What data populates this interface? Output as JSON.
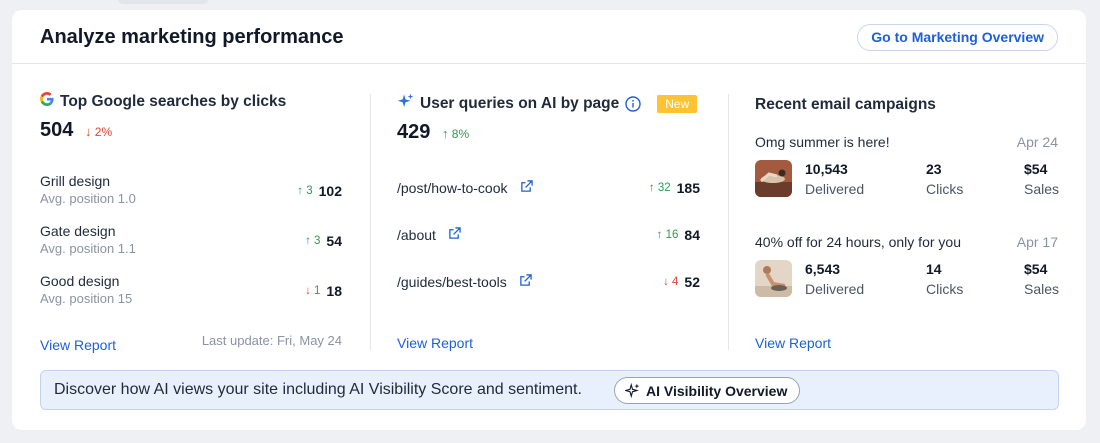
{
  "header": {
    "title": "Analyze marketing performance",
    "overview_button": "Go to Marketing Overview"
  },
  "google": {
    "title": "Top Google searches by clicks",
    "total": "504",
    "trend": "2%",
    "trend_dir": "down",
    "rows": [
      {
        "name": "Grill design",
        "position": "Avg. position 1.0",
        "delta": "3",
        "dir": "up",
        "value": "102"
      },
      {
        "name": "Gate design",
        "position": "Avg. position 1.1",
        "delta": "3",
        "dir": "up",
        "value": "54"
      },
      {
        "name": "Good design",
        "position": "Avg. position 15",
        "delta": "1",
        "dir": "down",
        "value": "18"
      }
    ],
    "view_report": "View Report",
    "last_update": "Last update: Fri, May 24"
  },
  "ai_queries": {
    "title": "User queries on AI by page",
    "badge": "New",
    "total": "429",
    "trend": "8%",
    "trend_dir": "up",
    "rows": [
      {
        "path": "/post/how-to-cook",
        "delta": "32",
        "dir": "up",
        "value": "185"
      },
      {
        "path": "/about",
        "delta": "16",
        "dir": "up",
        "value": "84"
      },
      {
        "path": "/guides/best-tools",
        "delta": "4",
        "dir": "down",
        "value": "52"
      }
    ],
    "view_report": "View Report"
  },
  "email": {
    "title": "Recent email campaigns",
    "campaigns": [
      {
        "name": "Omg summer is here!",
        "date": "Apr 24",
        "delivered": "10,543",
        "delivered_label": "Delivered",
        "clicks": "23",
        "clicks_label": "Clicks",
        "sales": "$54",
        "sales_label": "Sales"
      },
      {
        "name": "40% off for 24 hours, only for you",
        "date": "Apr 17",
        "delivered": "6,543",
        "delivered_label": "Delivered",
        "clicks": "14",
        "clicks_label": "Clicks",
        "sales": "$54",
        "sales_label": "Sales"
      }
    ],
    "view_report": "View Report"
  },
  "banner": {
    "text": "Discover how AI views your site including AI Visibility Score and sentiment.",
    "button": "AI Visibility Overview"
  },
  "colors": {
    "link": "#1f5fd8",
    "up": "#2f9b4a",
    "down": "#e0463a",
    "new_badge": "#ffc233",
    "banner_bg": "#e8f0fd"
  }
}
